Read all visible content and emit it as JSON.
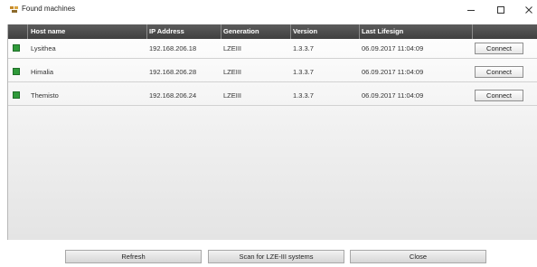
{
  "window": {
    "title": "Found machines",
    "icon": "network-machines-icon",
    "controls": {
      "minimize": "–",
      "maximize": "☐",
      "close": "✕"
    }
  },
  "table": {
    "columns": [
      "Host name",
      "IP Address",
      "Generation",
      "Version",
      "Last Lifesign",
      ""
    ],
    "rows": [
      {
        "host": "Lysithea",
        "ip": "192.168.206.18",
        "generation": "LZEIII",
        "version": "1.3.3.7",
        "lifesign": "06.09.2017 11:04:09",
        "action": "Connect",
        "status_color": "#2f9a3a"
      },
      {
        "host": "Himalia",
        "ip": "192.168.206.28",
        "generation": "LZEIII",
        "version": "1.3.3.7",
        "lifesign": "06.09.2017 11:04:09",
        "action": "Connect",
        "status_color": "#2f9a3a"
      },
      {
        "host": "Themisto",
        "ip": "192.168.206.24",
        "generation": "LZEIII",
        "version": "1.3.3.7",
        "lifesign": "06.09.2017 11:04:09",
        "action": "Connect",
        "status_color": "#2f9a3a"
      }
    ]
  },
  "buttons": {
    "refresh": "Refresh",
    "scan": "Scan for LZE-III systems",
    "close": "Close"
  }
}
